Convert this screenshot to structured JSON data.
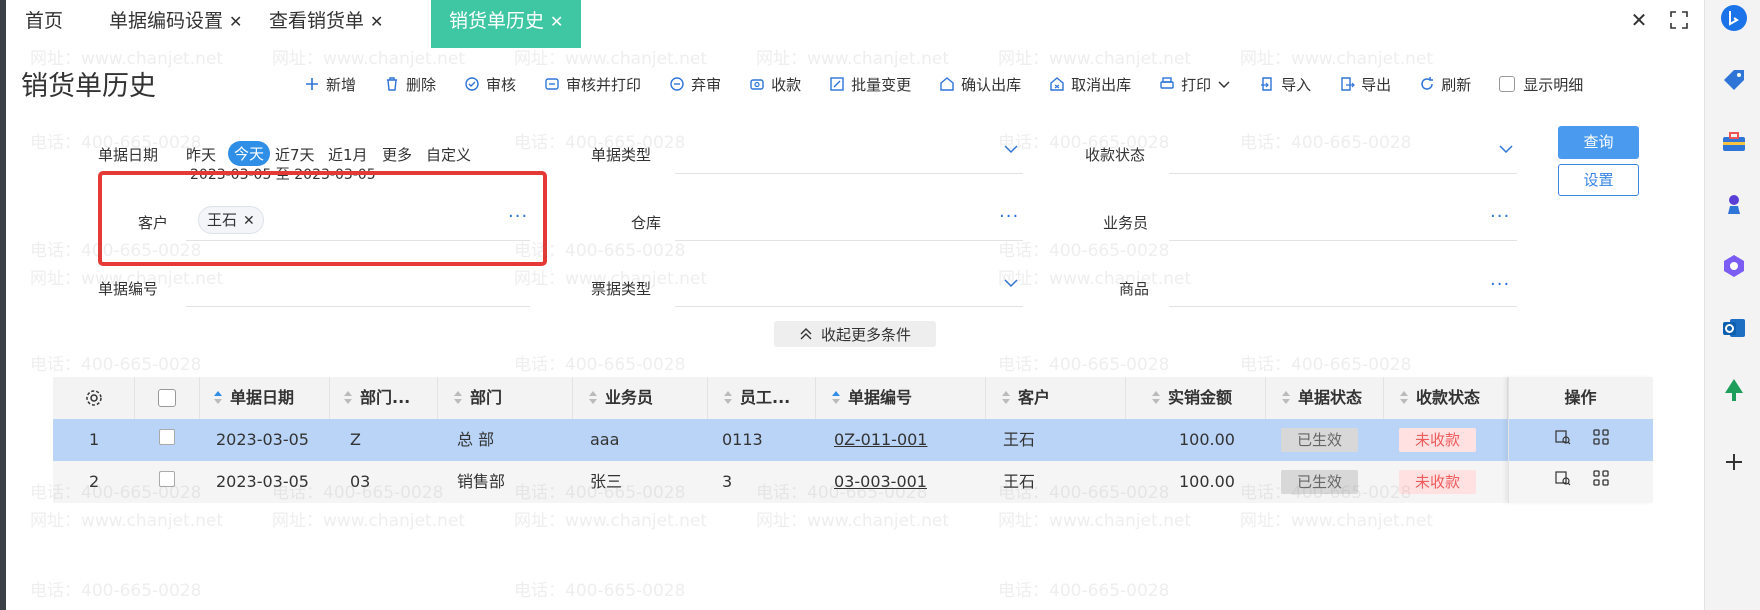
{
  "tabs": [
    {
      "label": "首页",
      "closable": false,
      "active": false
    },
    {
      "label": "单据编码设置",
      "closable": true,
      "active": false
    },
    {
      "label": "查看销货单",
      "closable": true,
      "active": false
    },
    {
      "label": "销货单历史",
      "closable": true,
      "active": true
    }
  ],
  "page": {
    "title": "销货单历史"
  },
  "toolbar": {
    "items": [
      {
        "label": "新增",
        "icon": "plus-icon"
      },
      {
        "label": "删除",
        "icon": "trash-icon"
      },
      {
        "label": "审核",
        "icon": "audit-icon"
      },
      {
        "label": "审核并打印",
        "icon": "audit-print-icon"
      },
      {
        "label": "弃审",
        "icon": "unaudit-icon"
      },
      {
        "label": "收款",
        "icon": "receipt-icon"
      },
      {
        "label": "批量变更",
        "icon": "batch-edit-icon"
      },
      {
        "label": "确认出库",
        "icon": "confirm-out-icon"
      },
      {
        "label": "取消出库",
        "icon": "cancel-out-icon"
      },
      {
        "label": "打印",
        "icon": "printer-icon"
      },
      {
        "label": "导入",
        "icon": "import-icon"
      },
      {
        "label": "导出",
        "icon": "export-icon"
      },
      {
        "label": "刷新",
        "icon": "refresh-icon"
      }
    ],
    "show_detail": "显示明细"
  },
  "filters": {
    "date_label": "单据日期",
    "date_options": [
      "昨天",
      "今天",
      "近7天",
      "近1月",
      "更多",
      "自定义"
    ],
    "date_selected": "今天",
    "date_range": "2023-03-05 至 2023-03-05",
    "customer_label": "客户",
    "customer_tag": "王石",
    "doc_no_label": "单据编号",
    "doc_type_label": "单据类型",
    "warehouse_label": "仓库",
    "ticket_type_label": "票据类型",
    "payment_status_label": "收款状态",
    "salesperson_label": "业务员",
    "product_label": "商品",
    "query_button": "查询",
    "settings_button": "设置",
    "collapse_label": "收起更多条件"
  },
  "grid": {
    "columns": [
      "单据日期",
      "部门...",
      "部门",
      "业务员",
      "员工...",
      "单据编号",
      "客户",
      "实销金额",
      "单据状态",
      "收款状态",
      "操作"
    ],
    "rows": [
      {
        "index": "1",
        "date": "2023-03-05",
        "dept_code": "Z",
        "dept": "总 部",
        "salesperson": "aaa",
        "emp_code": "0113",
        "doc_no": "0Z-011-001",
        "customer": "王石",
        "amount": "100.00",
        "doc_status": "已生效",
        "pay_status": "未收款"
      },
      {
        "index": "2",
        "date": "2023-03-05",
        "dept_code": "03",
        "dept": "销售部",
        "salesperson": "张三",
        "emp_code": "3",
        "doc_no": "03-003-001",
        "customer": "王石",
        "amount": "100.00",
        "doc_status": "已生效",
        "pay_status": "未收款"
      }
    ]
  },
  "watermark": {
    "phone": "电话：400-665-0028",
    "site": "网址：www.chanjet.net"
  },
  "colors": {
    "accent_tab": "#3fc7a4",
    "primary": "#4a9bf0",
    "selected_row": "#b9d4f7",
    "highlight": "#e53935",
    "unpaid": "#f05b5b"
  }
}
